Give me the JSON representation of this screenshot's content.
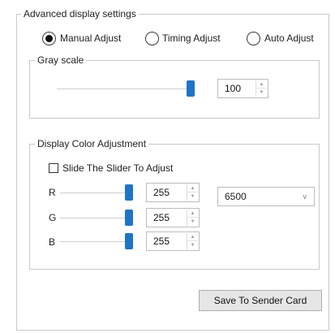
{
  "panel": {
    "title": "Advanced display settings"
  },
  "modes": {
    "selected": "Manual Adjust",
    "options": [
      "Manual Adjust",
      "Timing Adjust",
      "Auto Adjust"
    ]
  },
  "grayscale": {
    "title": "Gray scale",
    "value": "100",
    "level": 100
  },
  "color": {
    "title": "Display Color Adjustment",
    "checkbox_label": "Slide The Slider To Adjust",
    "checkbox_checked": false,
    "channels": [
      {
        "label": "R",
        "value": "255"
      },
      {
        "label": "G",
        "value": "255"
      },
      {
        "label": "B",
        "value": "255"
      }
    ],
    "temperature": "6500"
  },
  "buttons": {
    "save_label": "Save To Sender Card"
  },
  "colors": {
    "accent": "#1f74c6"
  },
  "icons": {
    "spin_up": "▲",
    "spin_down": "▼",
    "dropdown": "∨"
  }
}
